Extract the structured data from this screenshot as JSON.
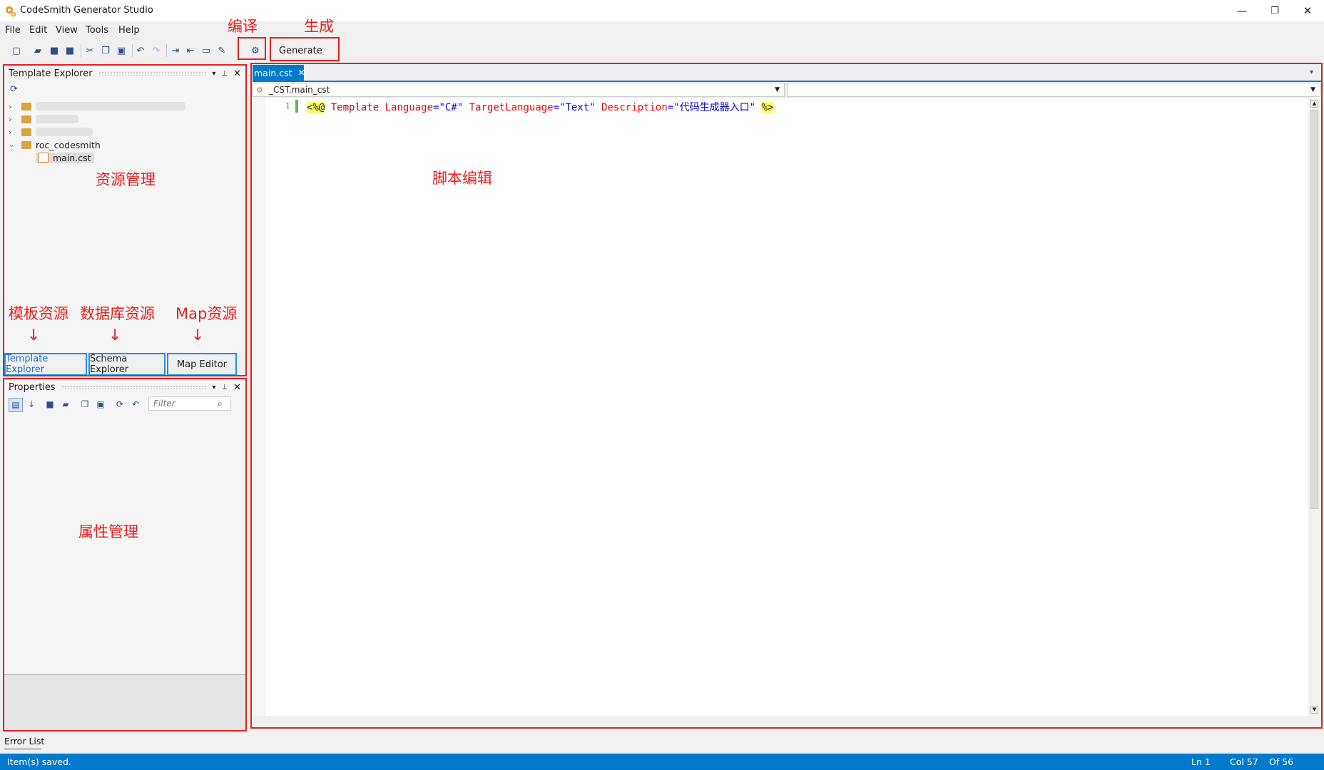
{
  "window": {
    "title": "CodeSmith Generator Studio",
    "minimize": "—",
    "restore": "❐",
    "close": "✕"
  },
  "menu": {
    "file": "File",
    "edit": "Edit",
    "view": "View",
    "tools": "Tools",
    "help": "Help"
  },
  "toolbar": {
    "generate_label": "Generate"
  },
  "annotations": {
    "compile": "编译",
    "generate": "生成",
    "resource_mgmt": "资源管理",
    "script_edit": "脚本编辑",
    "template_res": "模板资源",
    "db_res": "数据库资源",
    "map_res": "Map资源",
    "property_mgmt": "属性管理"
  },
  "template_explorer": {
    "title": "Template Explorer",
    "tree": {
      "folder_name": "roc_codesmith",
      "file_name": "main.cst"
    }
  },
  "bottom_tabs": {
    "template_explorer": "Template Explorer",
    "schema_explorer": "Schema Explorer",
    "map_editor": "Map Editor"
  },
  "properties": {
    "title": "Properties",
    "filter_placeholder": "Filter"
  },
  "editor": {
    "tab_label": "main.cst",
    "class_dropdown": "_CST.main_cst",
    "line_number": "1",
    "code": {
      "open": "<%@",
      "directive": " Template",
      "attr1": " Language",
      "eq1": "=",
      "val1": "\"C#\"",
      "attr2": " TargetLanguage",
      "eq2": "=",
      "val2": "\"Text\"",
      "attr3": " Description",
      "eq3": "=",
      "val3": "\"代码生成器入口\"",
      "close": "%>"
    }
  },
  "error_list": {
    "label": "Error List"
  },
  "status": {
    "message": "Item(s) saved.",
    "ln": "Ln 1",
    "col": "Col 57",
    "of": "Of 56"
  }
}
